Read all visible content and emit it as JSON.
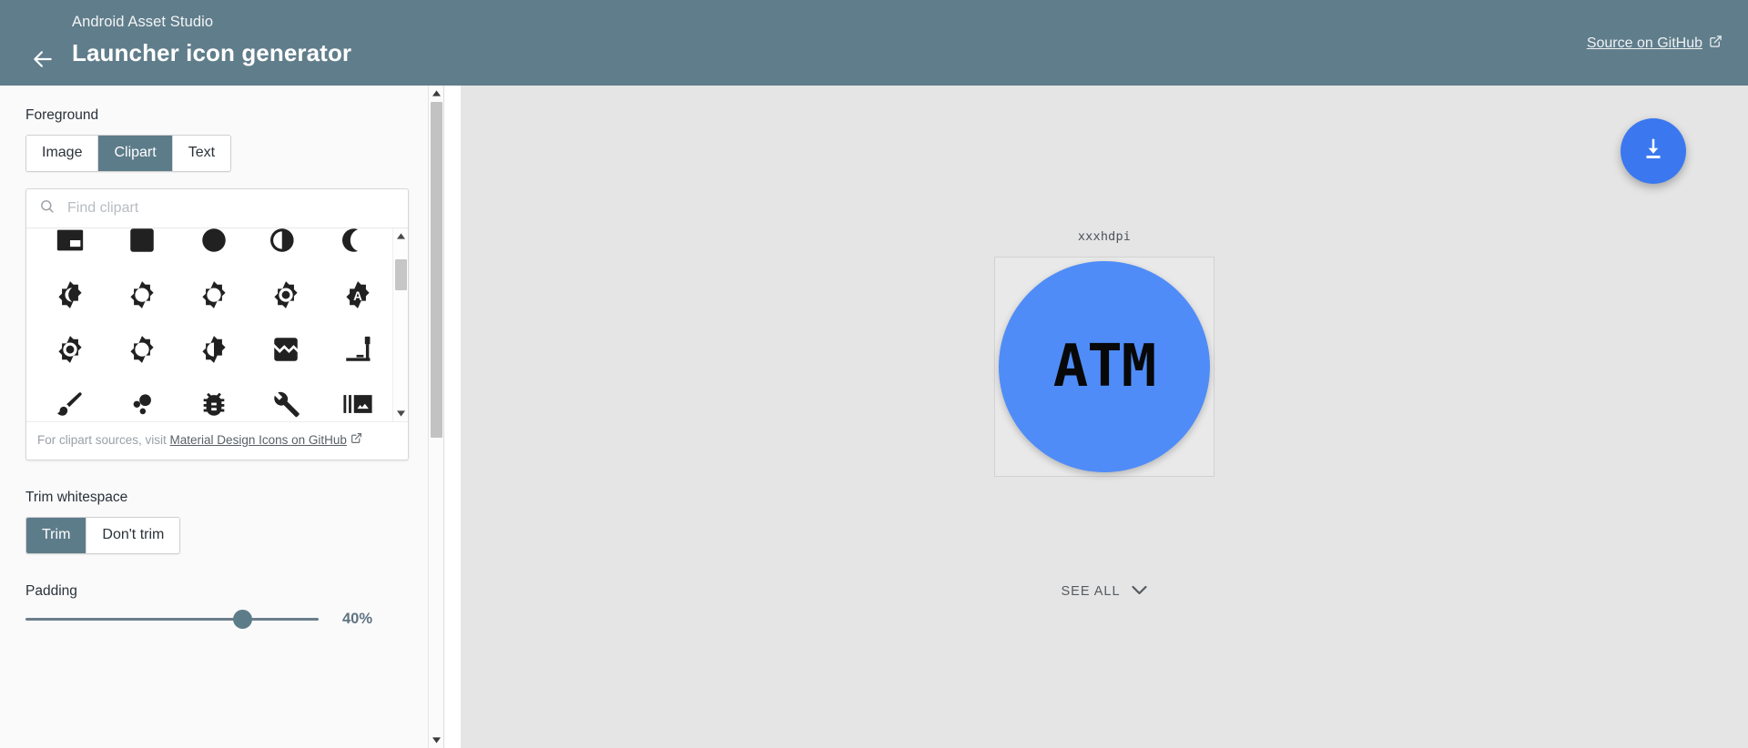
{
  "header": {
    "supertitle": "Android Asset Studio",
    "title": "Launcher icon generator",
    "back_icon": "arrow-left-icon",
    "source_link": "Source on GitHub",
    "source_icon": "external-link-icon"
  },
  "sidebar": {
    "foreground": {
      "label": "Foreground",
      "options": [
        "Image",
        "Clipart",
        "Text"
      ],
      "selected": "Clipart"
    },
    "clipart": {
      "search_placeholder": "Find clipart",
      "search_value": "",
      "search_icon": "search-icon",
      "note_prefix": "For clipart sources, visit ",
      "note_link": "Material Design Icons on GitHub",
      "note_icon": "external-link-icon",
      "items": [
        {
          "name": "branding-watermark-icon",
          "glyph": "branding_watermark"
        },
        {
          "name": "brightness-1-box-icon",
          "glyph": "brightness_box"
        },
        {
          "name": "brightness-1-icon",
          "glyph": "circle"
        },
        {
          "name": "brightness-2-icon",
          "glyph": "moon_half"
        },
        {
          "name": "brightness-3-icon",
          "glyph": "moon_crescent"
        },
        {
          "name": "brightness-4-icon",
          "glyph": "star_moon"
        },
        {
          "name": "brightness-5-icon",
          "glyph": "star_ring"
        },
        {
          "name": "brightness-6-icon",
          "glyph": "star_half"
        },
        {
          "name": "brightness-7-icon",
          "glyph": "star_dot"
        },
        {
          "name": "brightness-auto-icon",
          "glyph": "star_a"
        },
        {
          "name": "brightness-high-icon",
          "glyph": "star_dot"
        },
        {
          "name": "brightness-low-icon",
          "glyph": "star_ring"
        },
        {
          "name": "brightness-medium-icon",
          "glyph": "star_half"
        },
        {
          "name": "broken-image-icon",
          "glyph": "broken_image"
        },
        {
          "name": "brush-variant-icon",
          "glyph": "brush_variant"
        },
        {
          "name": "brush-icon",
          "glyph": "brush"
        },
        {
          "name": "bubble-chart-icon",
          "glyph": "bubble_chart"
        },
        {
          "name": "bug-report-icon",
          "glyph": "bug"
        },
        {
          "name": "build-icon",
          "glyph": "wrench"
        },
        {
          "name": "burst-mode-icon",
          "glyph": "burst_mode"
        }
      ]
    },
    "trim": {
      "label": "Trim whitespace",
      "options": [
        "Trim",
        "Don't trim"
      ],
      "selected": "Trim"
    },
    "padding": {
      "label": "Padding",
      "value": "40%",
      "percent": 40
    }
  },
  "preview": {
    "download_icon": "download-icon",
    "dpi_label": "xxxhdpi",
    "icon_text": "ATM",
    "icon_color": "#4f8cf7",
    "see_all_label": "SEE ALL",
    "see_all_icon": "chevron-down-icon"
  },
  "colors": {
    "header_bg": "#607d8b",
    "accent": "#5d7c8a",
    "fab": "#3b78ef",
    "preview_bg": "#e5e5e5"
  }
}
